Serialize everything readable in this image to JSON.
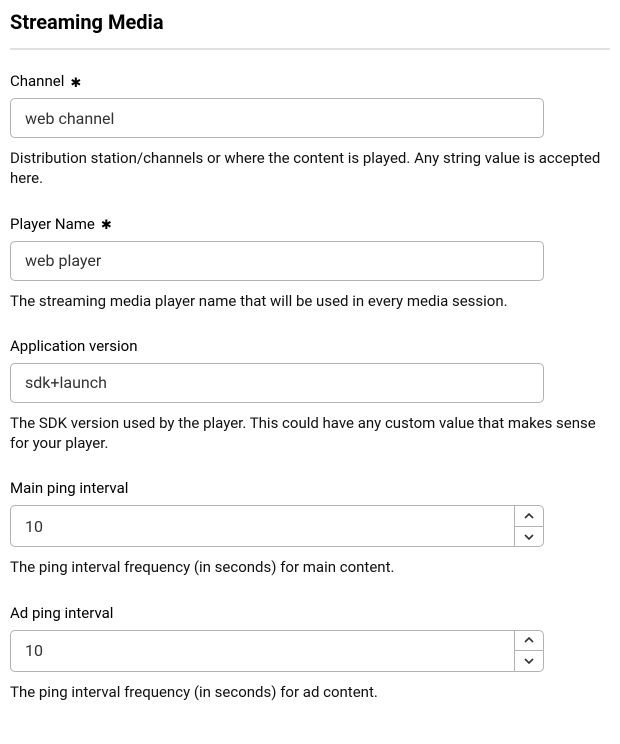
{
  "section": {
    "title": "Streaming Media"
  },
  "fields": {
    "channel": {
      "label": "Channel",
      "required_mark": "✱",
      "value": "web channel",
      "help": "Distribution station/channels or where the content is played. Any string value is accepted here."
    },
    "playerName": {
      "label": "Player Name",
      "required_mark": "✱",
      "value": "web player",
      "help": "The streaming media player name that will be used in every media session."
    },
    "appVersion": {
      "label": "Application version",
      "value": "sdk+launch",
      "help": "The SDK version used by the player. This could have any custom value that makes sense for your player."
    },
    "mainPing": {
      "label": "Main ping interval",
      "value": "10",
      "help": "The ping interval frequency (in seconds) for main content."
    },
    "adPing": {
      "label": "Ad ping interval",
      "value": "10",
      "help": "The ping interval frequency (in seconds) for ad content."
    }
  }
}
